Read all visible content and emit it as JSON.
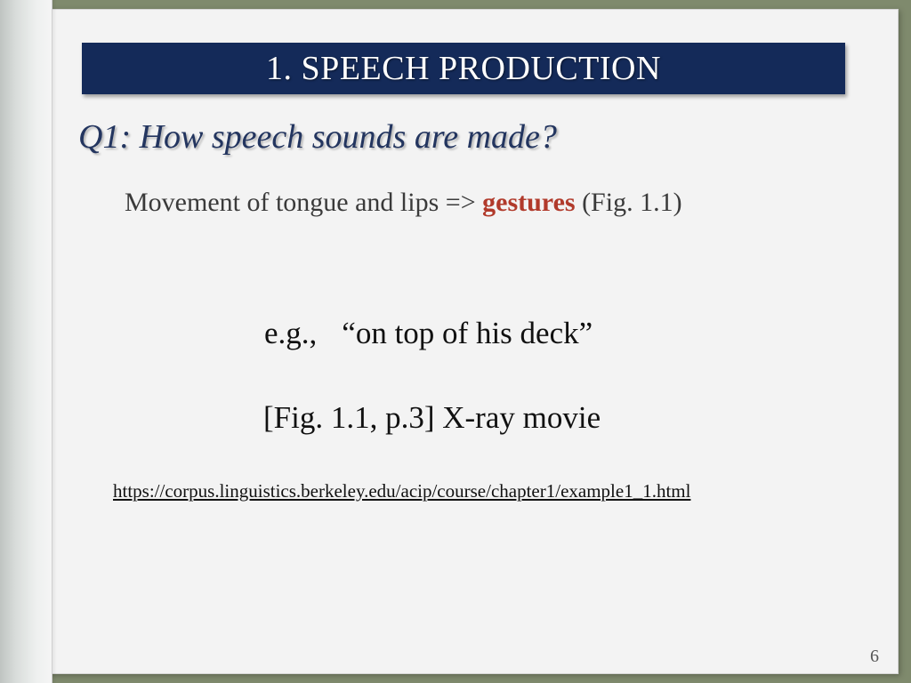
{
  "slide": {
    "title": "1. SPEECH PRODUCTION",
    "question": "Q1: How speech sounds are made?",
    "bullet": {
      "prefix": "Movement of tongue and lips => ",
      "highlight": "gestures",
      "suffix": " (Fig. 1.1)"
    },
    "example": {
      "label": "e.g.,",
      "phrase": "“on top of his deck”"
    },
    "figure_reference": "[Fig. 1.1, p.3] X-ray movie",
    "link": "https://corpus.linguistics.berkeley.edu/acip/course/chapter1/example1_1.html",
    "page_number": "6"
  },
  "colors": {
    "title_bar": "#142a59",
    "question_text": "#23355f",
    "highlight": "#b13a2b",
    "frame": "#8e977c",
    "page": "#f3f3f3"
  }
}
